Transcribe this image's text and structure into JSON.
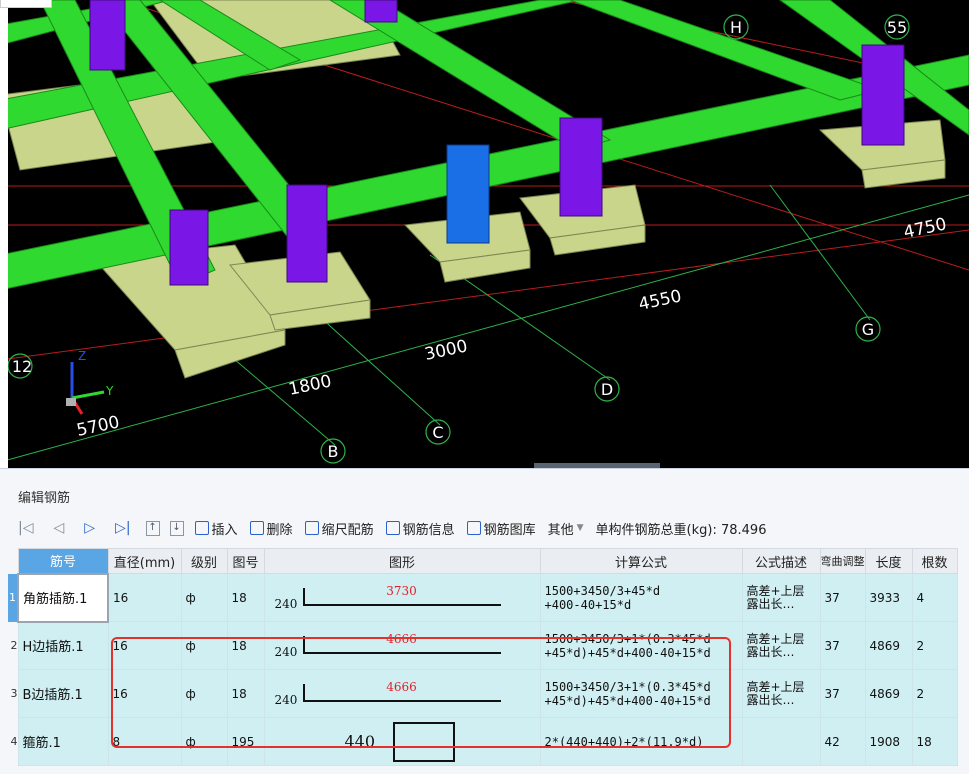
{
  "viewport": {
    "axis_labels": {
      "top_h": "H",
      "top_55": "55",
      "g": "G",
      "d": "D",
      "c": "C",
      "b": "B",
      "left_12": "12"
    },
    "dimensions": {
      "d4750": "4750",
      "d4550": "4550",
      "d3000": "3000",
      "d1800": "1800",
      "d5700": "5700"
    },
    "coord_axes": {
      "y": "Y",
      "z": "Z"
    },
    "colors": {
      "beam": "#2fd92f",
      "footing": "#c9d58a",
      "column": "#7a16e6",
      "column_selected": "#1a6fe6",
      "grid_line": "#b81d1d",
      "dim_line": "#2db44a"
    }
  },
  "panel": {
    "title": "编辑钢筋",
    "toolbar": {
      "nav_first": "|◁",
      "nav_prev": "◁",
      "nav_next": "▷",
      "nav_last": "▷|",
      "up": "↑",
      "down": "↓",
      "insert": "插入",
      "delete": "删除",
      "scale_rebar": "缩尺配筋",
      "rebar_info": "钢筋信息",
      "rebar_library": "钢筋图库",
      "other": "其他",
      "total_weight": "单构件钢筋总重(kg): 78.496"
    },
    "columns": [
      "筋号",
      "直径(mm)",
      "级别",
      "图号",
      "图形",
      "计算公式",
      "公式描述",
      "弯曲调整",
      "长度",
      "根数"
    ],
    "rows": [
      {
        "num": "1",
        "name": "角筋插筋.1",
        "diameter": "16",
        "grade": "ф",
        "fig": "18",
        "shape_left": "240",
        "shape_len": "3730",
        "formula": "1500+3450/3+45*d\n+400-40+15*d",
        "desc": "高差+上层\n露出长…",
        "bend": "37",
        "length": "3933",
        "count": "4"
      },
      {
        "num": "2",
        "name": "H边插筋.1",
        "diameter": "16",
        "grade": "ф",
        "fig": "18",
        "shape_left": "240",
        "shape_len": "4666",
        "formula": "1500+3450/3+1*(0.3*45*d\n+45*d)+45*d+400-40+15*d",
        "desc": "高差+上层\n露出长…",
        "bend": "37",
        "length": "4869",
        "count": "2"
      },
      {
        "num": "3",
        "name": "B边插筋.1",
        "diameter": "16",
        "grade": "ф",
        "fig": "18",
        "shape_left": "240",
        "shape_len": "4666",
        "formula": "1500+3450/3+1*(0.3*45*d\n+45*d)+45*d+400-40+15*d",
        "desc": "高差+上层\n露出长…",
        "bend": "37",
        "length": "4869",
        "count": "2"
      },
      {
        "num": "4",
        "name": "箍筋.1",
        "diameter": "8",
        "grade": "ф",
        "fig": "195",
        "shape_left": "440",
        "shape_len": "",
        "formula": "2*(440+440)+2*(11.9*d)",
        "desc": "",
        "bend": "42",
        "length": "1908",
        "count": "18"
      }
    ]
  }
}
